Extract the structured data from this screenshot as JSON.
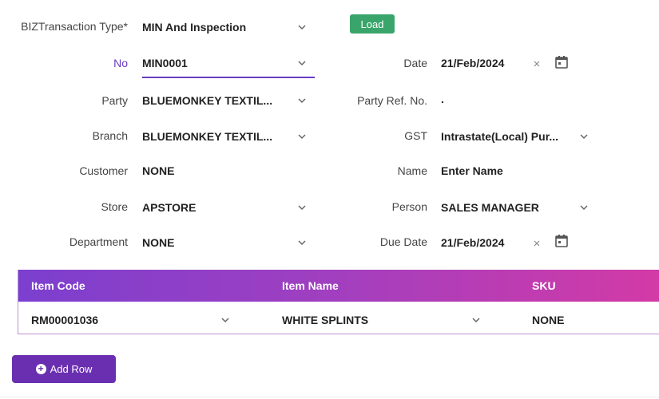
{
  "form": {
    "transaction_type": {
      "label": "BIZTransaction Type*",
      "value": "MIN And Inspection"
    },
    "load_label": "Load",
    "no": {
      "label": "No",
      "value": "MIN0001"
    },
    "date": {
      "label": "Date",
      "value": "21/Feb/2024"
    },
    "party": {
      "label": "Party",
      "value": "BLUEMONKEY TEXTIL..."
    },
    "party_ref": {
      "label": "Party Ref. No.",
      "value": "."
    },
    "branch": {
      "label": "Branch",
      "value": "BLUEMONKEY TEXTIL..."
    },
    "gst": {
      "label": "GST",
      "value": "Intrastate(Local) Pur..."
    },
    "customer": {
      "label": "Customer",
      "value": "NONE"
    },
    "name": {
      "label": "Name",
      "value": "Enter Name"
    },
    "store": {
      "label": "Store",
      "value": "APSTORE"
    },
    "person": {
      "label": "Person",
      "value": "SALES MANAGER"
    },
    "department": {
      "label": "Department",
      "value": "NONE"
    },
    "due_date": {
      "label": "Due Date",
      "value": "21/Feb/2024"
    }
  },
  "grid": {
    "columns": [
      "Item Code",
      "Item Name",
      "SKU"
    ],
    "rows": [
      {
        "item_code": "RM00001036",
        "item_name": "WHITE SPLINTS",
        "sku": "NONE"
      }
    ]
  },
  "add_row_label": "Add Row",
  "icons": {
    "dropdown": "chevron-down-icon",
    "clear": "close-icon",
    "calendar": "calendar-icon",
    "add": "plus-circle-icon"
  },
  "colors": {
    "accent": "#6a3bc0",
    "load": "#3aa56a",
    "header_start": "#7b3fcf",
    "header_end": "#d33aa6"
  }
}
